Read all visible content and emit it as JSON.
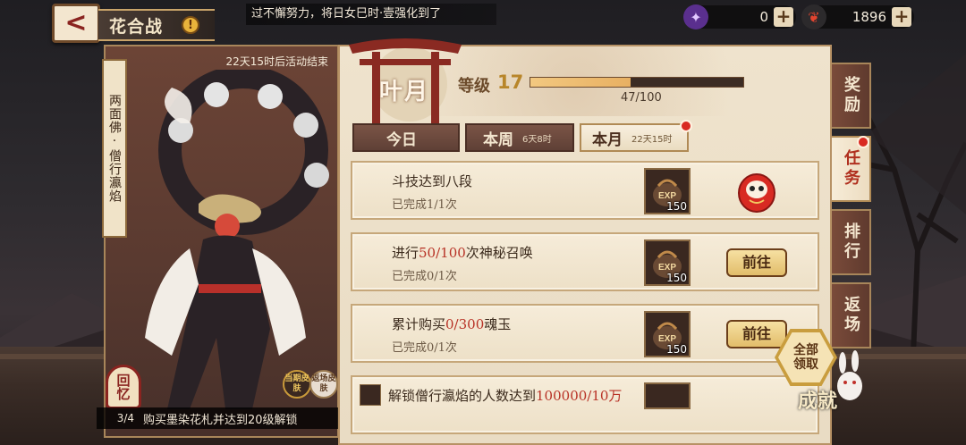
{
  "header": {
    "back_label": "<",
    "title": "花合战",
    "warning": "!",
    "ticker": "过不懈努力，将日女巳时·壹强化到了"
  },
  "currencies": [
    {
      "icon": "jade-orb-icon",
      "value": "0",
      "color": "#8a4fd0"
    },
    {
      "icon": "red-fish-token-icon",
      "value": "1896",
      "color": "#d13a2e"
    }
  ],
  "character": {
    "name": "两面佛·僧行瀛焰",
    "event_timer": "22天15时后活动结束",
    "recall_label": "回忆",
    "skin_current": "当期皮肤",
    "skin_return": "返场皮肤",
    "unlock_count": "3/4",
    "unlock_text": "购买墨染花札并达到20级解锁"
  },
  "season": {
    "month_name": "叶月",
    "level_label": "等级",
    "level": "17",
    "progress_text": "47/100",
    "progress_value": 0.47
  },
  "tabs": [
    {
      "label": "今日",
      "sub": ""
    },
    {
      "label": "本周",
      "sub": "6天8时"
    },
    {
      "label": "本月",
      "sub": "22天15时",
      "active": true
    }
  ],
  "tasks": [
    {
      "pre": "斗技达到八段",
      "hl": "",
      "post": "",
      "done": "已完成1/1次",
      "reward_qty": "150",
      "action": ""
    },
    {
      "pre": "进行",
      "hl": "50/100",
      "post": "次神秘召唤",
      "done": "已完成0/1次",
      "reward_qty": "150",
      "action": "前往"
    },
    {
      "pre": "累计购买",
      "hl": "0/300",
      "post": "魂玉",
      "done": "已完成0/1次",
      "reward_qty": "150",
      "action": "前往"
    },
    {
      "pre": "解锁僧行瀛焰的人数达到",
      "hl": "100000/10万",
      "post": "",
      "done": "",
      "reward_qty": "",
      "action": ""
    }
  ],
  "side_tabs": [
    "奖励",
    "任务",
    "排行",
    "返场"
  ],
  "claim_all": "全部领取",
  "achievement": "成就",
  "colors": {
    "accent_red": "#b83226",
    "parchment": "#efe3cd",
    "frame": "#b79265"
  }
}
